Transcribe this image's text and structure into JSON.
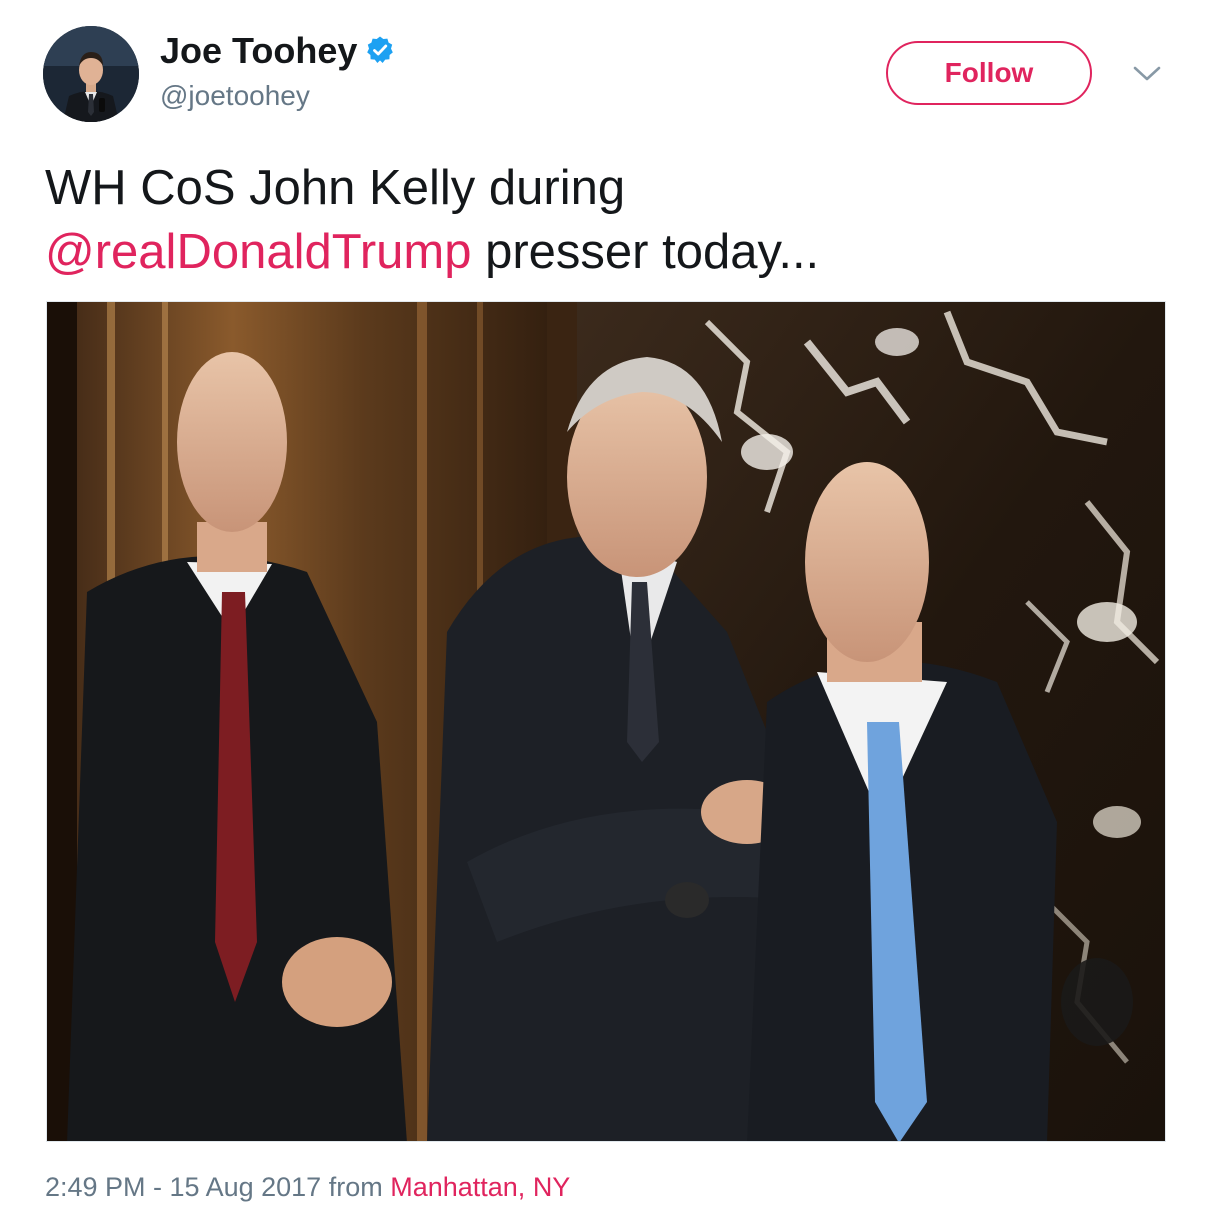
{
  "author": {
    "display_name": "Joe Toohey",
    "handle": "@joetoohey",
    "verified": true,
    "verified_icon": "verified-badge-icon"
  },
  "actions": {
    "follow_label": "Follow",
    "menu_icon": "chevron-down-icon"
  },
  "tweet": {
    "text_line1": "WH CoS John Kelly during",
    "mention": "@realDonaldTrump",
    "text_line2_rest": " presser today...",
    "media_alt": "photo"
  },
  "meta": {
    "time": "2:49 PM - 15 Aug 2017",
    "from_label": " from ",
    "location": "Manhattan, NY"
  },
  "colors": {
    "accent": "#e0245e",
    "verified": "#1da1f2",
    "secondary_text": "#657786",
    "primary_text": "#14171a"
  }
}
